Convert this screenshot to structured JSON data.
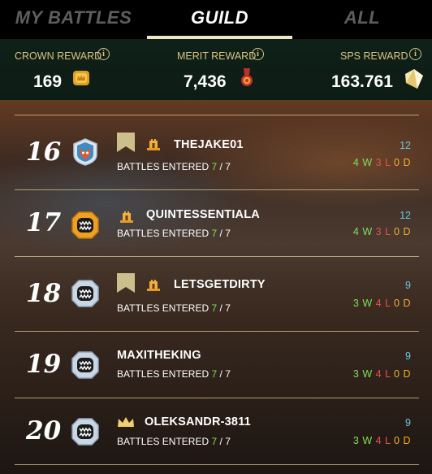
{
  "tabs": [
    {
      "label": "MY BATTLES",
      "active": false
    },
    {
      "label": "GUILD",
      "active": true
    },
    {
      "label": "ALL",
      "active": false
    }
  ],
  "rewards": {
    "crown": {
      "label": "CROWN REWARD",
      "value": "169",
      "icon": "crown-coin-icon"
    },
    "merit": {
      "label": "MERIT REWARD",
      "value": "7,436",
      "icon": "merit-medal-icon"
    },
    "sps": {
      "label": "SPS REWARD",
      "value": "163.761",
      "icon": "sps-token-icon"
    }
  },
  "battles_label": "BATTLES ENTERED",
  "rows": [
    {
      "rank": "16",
      "name": "THEJAKE01",
      "entered": "7",
      "total": "7",
      "score": "12",
      "wins": "4",
      "losses": "3",
      "draws": "0",
      "avatar": "fox-avatar-icon",
      "badges": [
        "bookmark-flag-icon",
        "guild-tower-icon"
      ]
    },
    {
      "rank": "17",
      "name": "QUINTESSENTIALA",
      "entered": "7",
      "total": "7",
      "score": "12",
      "wins": "4",
      "losses": "3",
      "draws": "0",
      "avatar": "orange-monster-avatar-icon",
      "badges": [
        "guild-tower-icon"
      ]
    },
    {
      "rank": "18",
      "name": "LETSGETDIRTY",
      "entered": "7",
      "total": "7",
      "score": "9",
      "wins": "3",
      "losses": "4",
      "draws": "0",
      "avatar": "silver-monster-avatar-icon",
      "badges": [
        "bookmark-flag-icon",
        "guild-tower-icon"
      ]
    },
    {
      "rank": "19",
      "name": "MAXITHEKING",
      "entered": "7",
      "total": "7",
      "score": "9",
      "wins": "3",
      "losses": "4",
      "draws": "0",
      "avatar": "silver-monster-avatar-icon",
      "badges": []
    },
    {
      "rank": "20",
      "name": "OLEKSANDR-3811",
      "entered": "7",
      "total": "7",
      "score": "9",
      "wins": "3",
      "losses": "4",
      "draws": "0",
      "avatar": "silver-monster-avatar-icon",
      "badges": [
        "crown-icon"
      ]
    }
  ],
  "colors": {
    "win": "#7ee05a",
    "loss": "#e8504a",
    "draw": "#f0b030",
    "score": "#69c8e0",
    "accent": "#d9c283"
  }
}
